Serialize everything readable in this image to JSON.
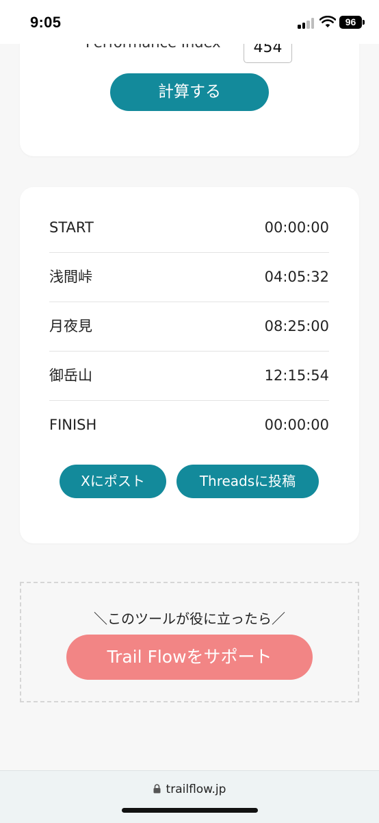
{
  "status_bar": {
    "time": "9:05",
    "battery": "96"
  },
  "calculator": {
    "performance_label": "Performance Index",
    "performance_value": "454",
    "calculate_button": "計算する"
  },
  "splits": [
    {
      "name": "START",
      "time": "00:00:00"
    },
    {
      "name": "浅間峠",
      "time": "04:05:32"
    },
    {
      "name": "月夜見",
      "time": "08:25:00"
    },
    {
      "name": "御岳山",
      "time": "12:15:54"
    },
    {
      "name": "FINISH",
      "time": "00:00:00"
    }
  ],
  "share": {
    "x_button": "Xにポスト",
    "threads_button": "Threadsに投稿"
  },
  "support": {
    "message": "＼このツールが役に立ったら／",
    "button": "Trail Flowをサポート"
  },
  "browser": {
    "url": "trailflow.jp"
  },
  "colors": {
    "accent": "#138a9b",
    "support": "#f28585",
    "background": "#f7f7f7"
  }
}
